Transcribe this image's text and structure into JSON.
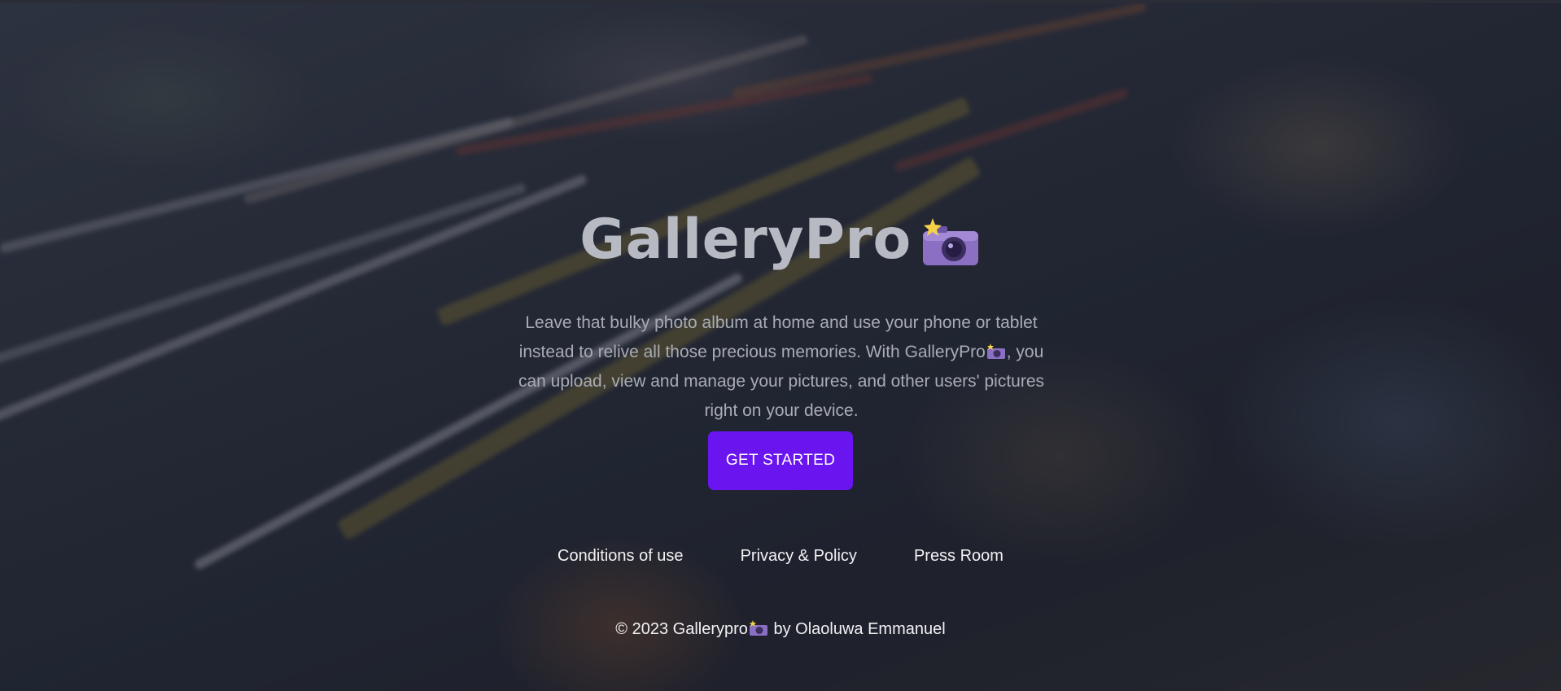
{
  "hero": {
    "title": "GalleryPro",
    "title_icon": "camera-with-flash-icon",
    "description_part1": "Leave that bulky photo album at home and use your phone or tablet instead to relive all those precious memories. With GalleryPro",
    "description_part2": ", you can upload, view and manage your pictures, and other users' pictures right on your device.",
    "cta_label": "GET STARTED"
  },
  "footer": {
    "links": [
      {
        "label": "Conditions of use"
      },
      {
        "label": "Privacy & Policy"
      },
      {
        "label": "Press Room"
      }
    ],
    "copyright_prefix": "© 2023 Gallerypro",
    "copyright_suffix": "by Olaoluwa Emmanuel"
  },
  "colors": {
    "accent": "#6a15f0",
    "title": "#b7bac3",
    "body_text": "#a9acb4",
    "footer_text": "#f2f2f4"
  }
}
